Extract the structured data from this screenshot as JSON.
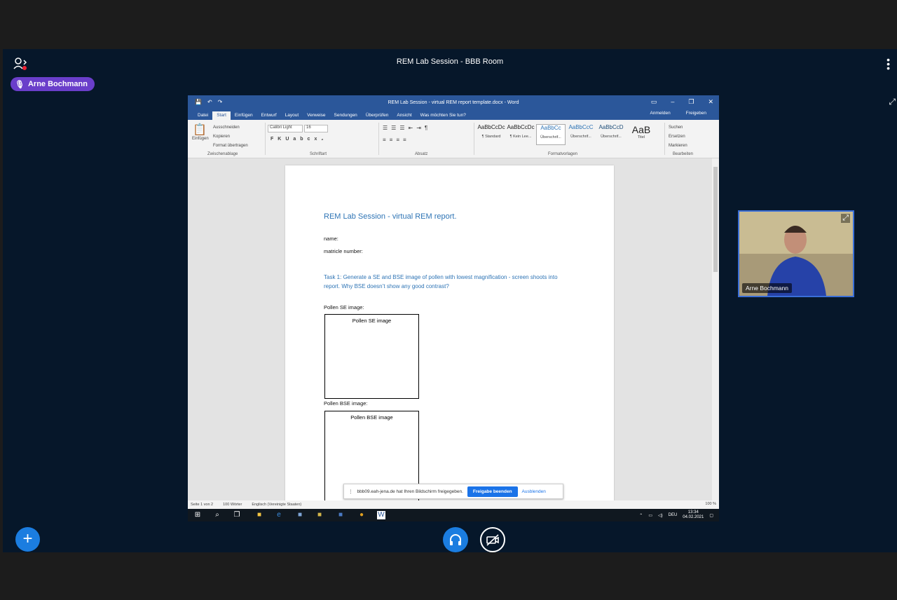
{
  "room": {
    "title": "REM Lab Session - BBB Room",
    "speaker_name": "Arne Bochmann",
    "webcam_name": "Arne Bochmann"
  },
  "word": {
    "window_title": "REM Lab Session - virtual REM report template.docx - Word",
    "tabs": [
      "Datei",
      "Start",
      "Einfügen",
      "Entwurf",
      "Layout",
      "Verweise",
      "Sendungen",
      "Überprüfen",
      "Ansicht"
    ],
    "tell_me": "Was möchten Sie tun?",
    "sign_in": "Anmelden",
    "share": "Freigeben",
    "clipboard": {
      "paste": "Einfügen",
      "cut": "Ausschneiden",
      "copy": "Kopieren",
      "format": "Format übertragen",
      "group": "Zwischenablage"
    },
    "font": {
      "name": "Calibri Light",
      "size": "16",
      "group": "Schriftart"
    },
    "paragraph_group": "Absatz",
    "styles": [
      {
        "preview": "AaBbCcDc",
        "label": "¶ Standard"
      },
      {
        "preview": "AaBbCcDc",
        "label": "¶ Kein Lee..."
      },
      {
        "preview": "AaBbCc",
        "label": "Überschrif..."
      },
      {
        "preview": "AaBbCcC",
        "label": "Überschrif..."
      },
      {
        "preview": "AaBbCcD",
        "label": "Überschrif..."
      },
      {
        "preview": "AaB",
        "label": "Titel"
      }
    ],
    "styles_group": "Formatvorlagen",
    "editing": {
      "find": "Suchen",
      "replace": "Ersetzen",
      "select": "Markieren",
      "group": "Bearbeiten"
    },
    "document": {
      "title": "REM Lab Session - virtual REM report.",
      "name_label": "name:",
      "matricle_label": "matricle number:",
      "task1": "Task 1: Generate a SE and BSE image of pollen with lowest magnification - screen shoots into report. Why BSE doesn’t show any good contrast?",
      "se_caption": "Pollen SE image:",
      "se_box": "Pollen SE image",
      "bse_caption": "Pollen BSE image:",
      "bse_box": "Pollen BSE image"
    },
    "status": {
      "page": "Seite 1 von 2",
      "words": "100 Wörter",
      "language": "Englisch (Vereinigte Staaten)",
      "zoom": "100 %"
    }
  },
  "share_notice": {
    "text": "bbb09.eah-jena.de hat Ihren Bildschirm freigegeben.",
    "stop": "Freigabe beenden",
    "hide": "Ausblenden"
  },
  "taskbar": {
    "lang": "DEU",
    "time": "13:34",
    "date": "04.02.2021"
  }
}
